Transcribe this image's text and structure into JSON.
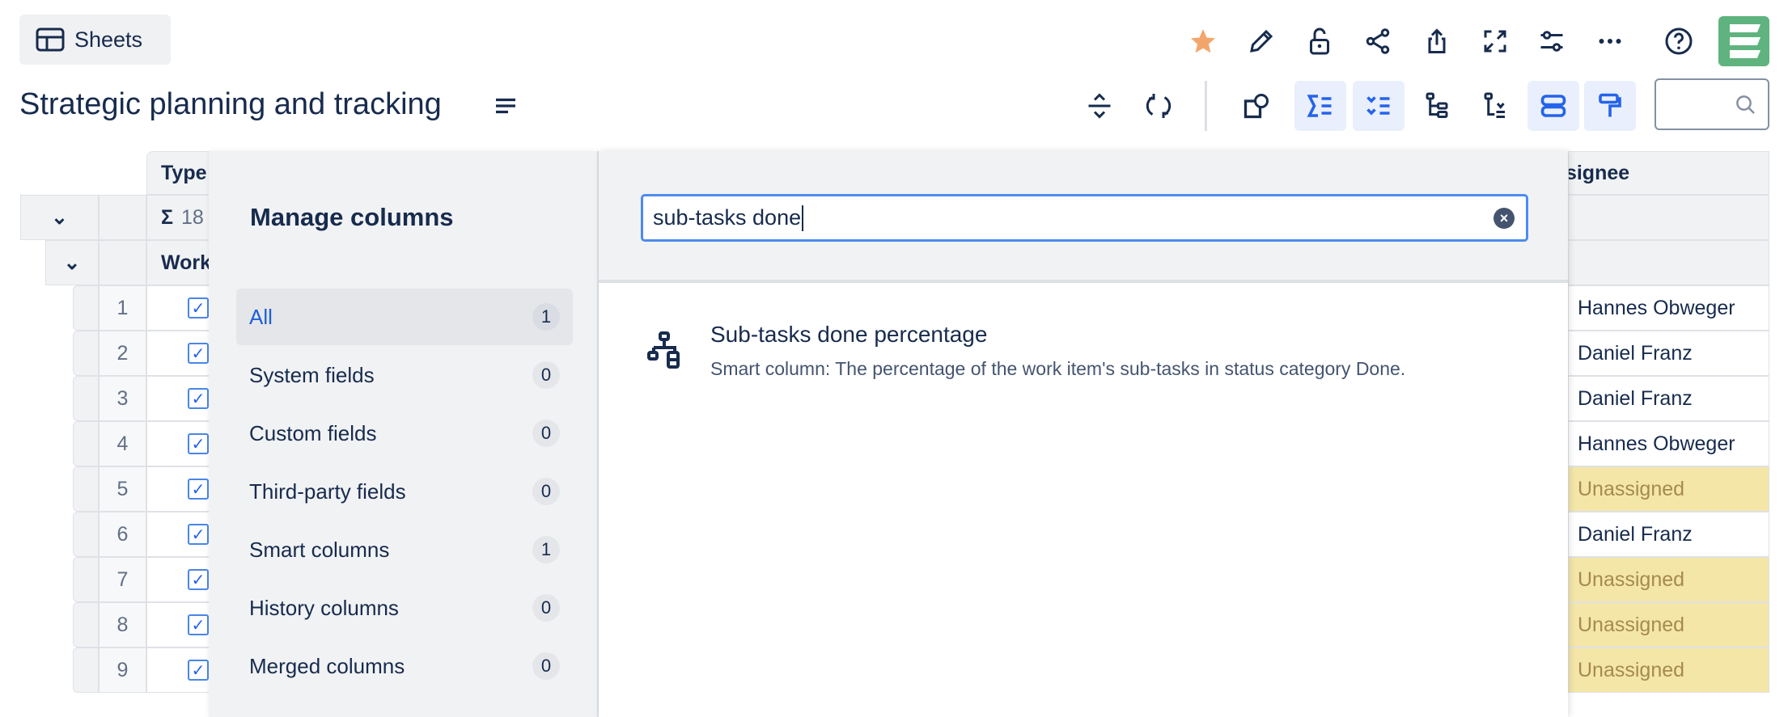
{
  "header": {
    "sheets_label": "Sheets",
    "title": "Strategic planning and tracking"
  },
  "toolbar_top": [
    "star-icon",
    "edit-icon",
    "unlock-icon",
    "share-icon",
    "export-icon",
    "fullscreen-icon",
    "settings-sliders-icon",
    "more-icon",
    "help-icon"
  ],
  "colors": {
    "accent": "#2563eb",
    "star": "#f2a66b",
    "logo": "#5fb37e",
    "unassigned_bg": "#f4e6a7"
  },
  "table": {
    "columns": {
      "type": "Type",
      "assignee": "Assignee"
    },
    "sum_row": {
      "symbol": "Σ",
      "value": "18"
    },
    "group_row": "Work",
    "rows": [
      {
        "num": "1",
        "assignee": "Hannes Obweger",
        "unassigned": false
      },
      {
        "num": "2",
        "assignee": "Daniel Franz",
        "unassigned": false
      },
      {
        "num": "3",
        "assignee": "Daniel Franz",
        "unassigned": false
      },
      {
        "num": "4",
        "assignee": "Hannes Obweger",
        "unassigned": false
      },
      {
        "num": "5",
        "assignee": "Unassigned",
        "unassigned": true
      },
      {
        "num": "6",
        "assignee": "Daniel Franz",
        "unassigned": false
      },
      {
        "num": "7",
        "assignee": "Unassigned",
        "unassigned": true
      },
      {
        "num": "8",
        "assignee": "Unassigned",
        "unassigned": true
      },
      {
        "num": "9",
        "assignee": "Unassigned",
        "unassigned": true
      }
    ]
  },
  "manage_columns": {
    "title": "Manage columns",
    "search_value": "sub-tasks done",
    "categories": [
      {
        "label": "All",
        "count": "1"
      },
      {
        "label": "System fields",
        "count": "0"
      },
      {
        "label": "Custom fields",
        "count": "0"
      },
      {
        "label": "Third-party fields",
        "count": "0"
      },
      {
        "label": "Smart columns",
        "count": "1"
      },
      {
        "label": "History columns",
        "count": "0"
      },
      {
        "label": "Merged columns",
        "count": "0"
      }
    ],
    "results": [
      {
        "title": "Sub-tasks done percentage",
        "description": "Smart column: The percentage of the work item's sub-tasks in status category Done."
      }
    ]
  }
}
